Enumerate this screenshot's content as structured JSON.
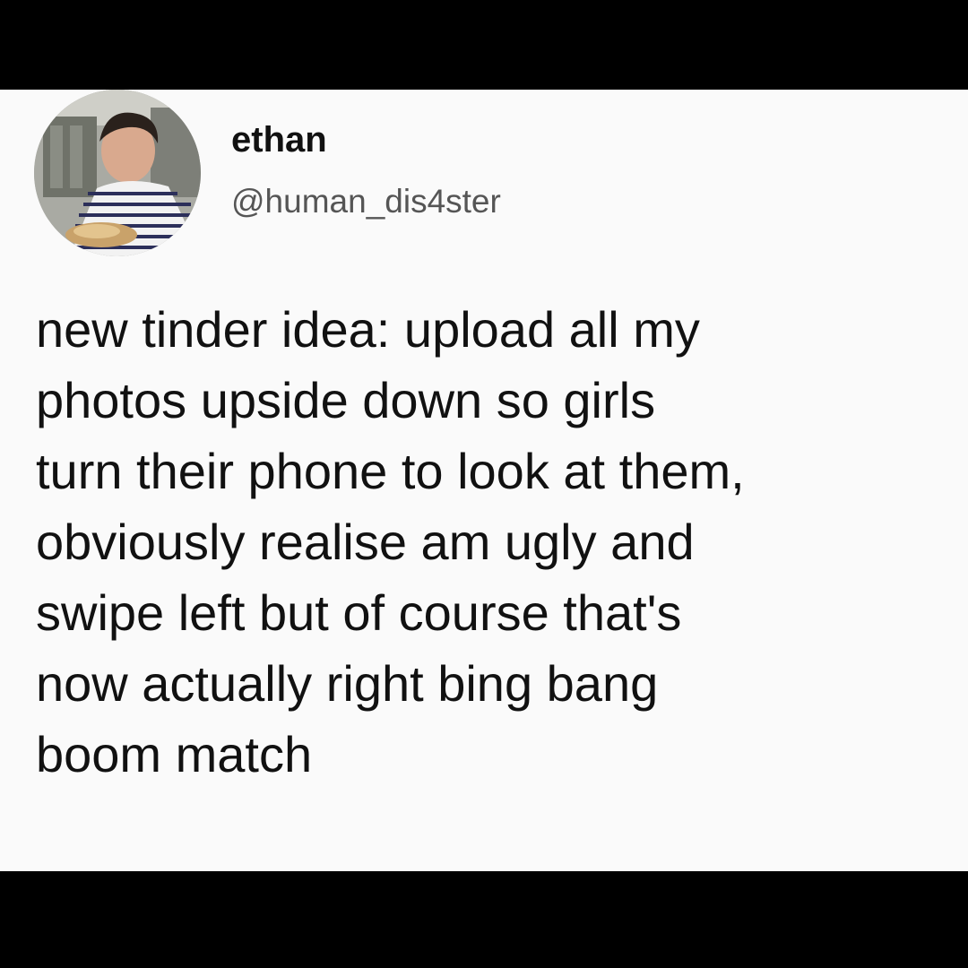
{
  "author": {
    "display_name": "ethan",
    "handle": "@human_dis4ster",
    "avatar_icon": "profile-photo"
  },
  "post": {
    "lines": [
      "new tinder idea: upload all my",
      "photos upside down so girls",
      "turn their phone to look at them,",
      "obviously realise am ugly and",
      "swipe left but of course that's",
      "now actually right bing bang",
      "boom match"
    ]
  },
  "colors": {
    "background": "#fafafa",
    "frame": "#000000",
    "text": "#111111",
    "handle": "#555555"
  }
}
